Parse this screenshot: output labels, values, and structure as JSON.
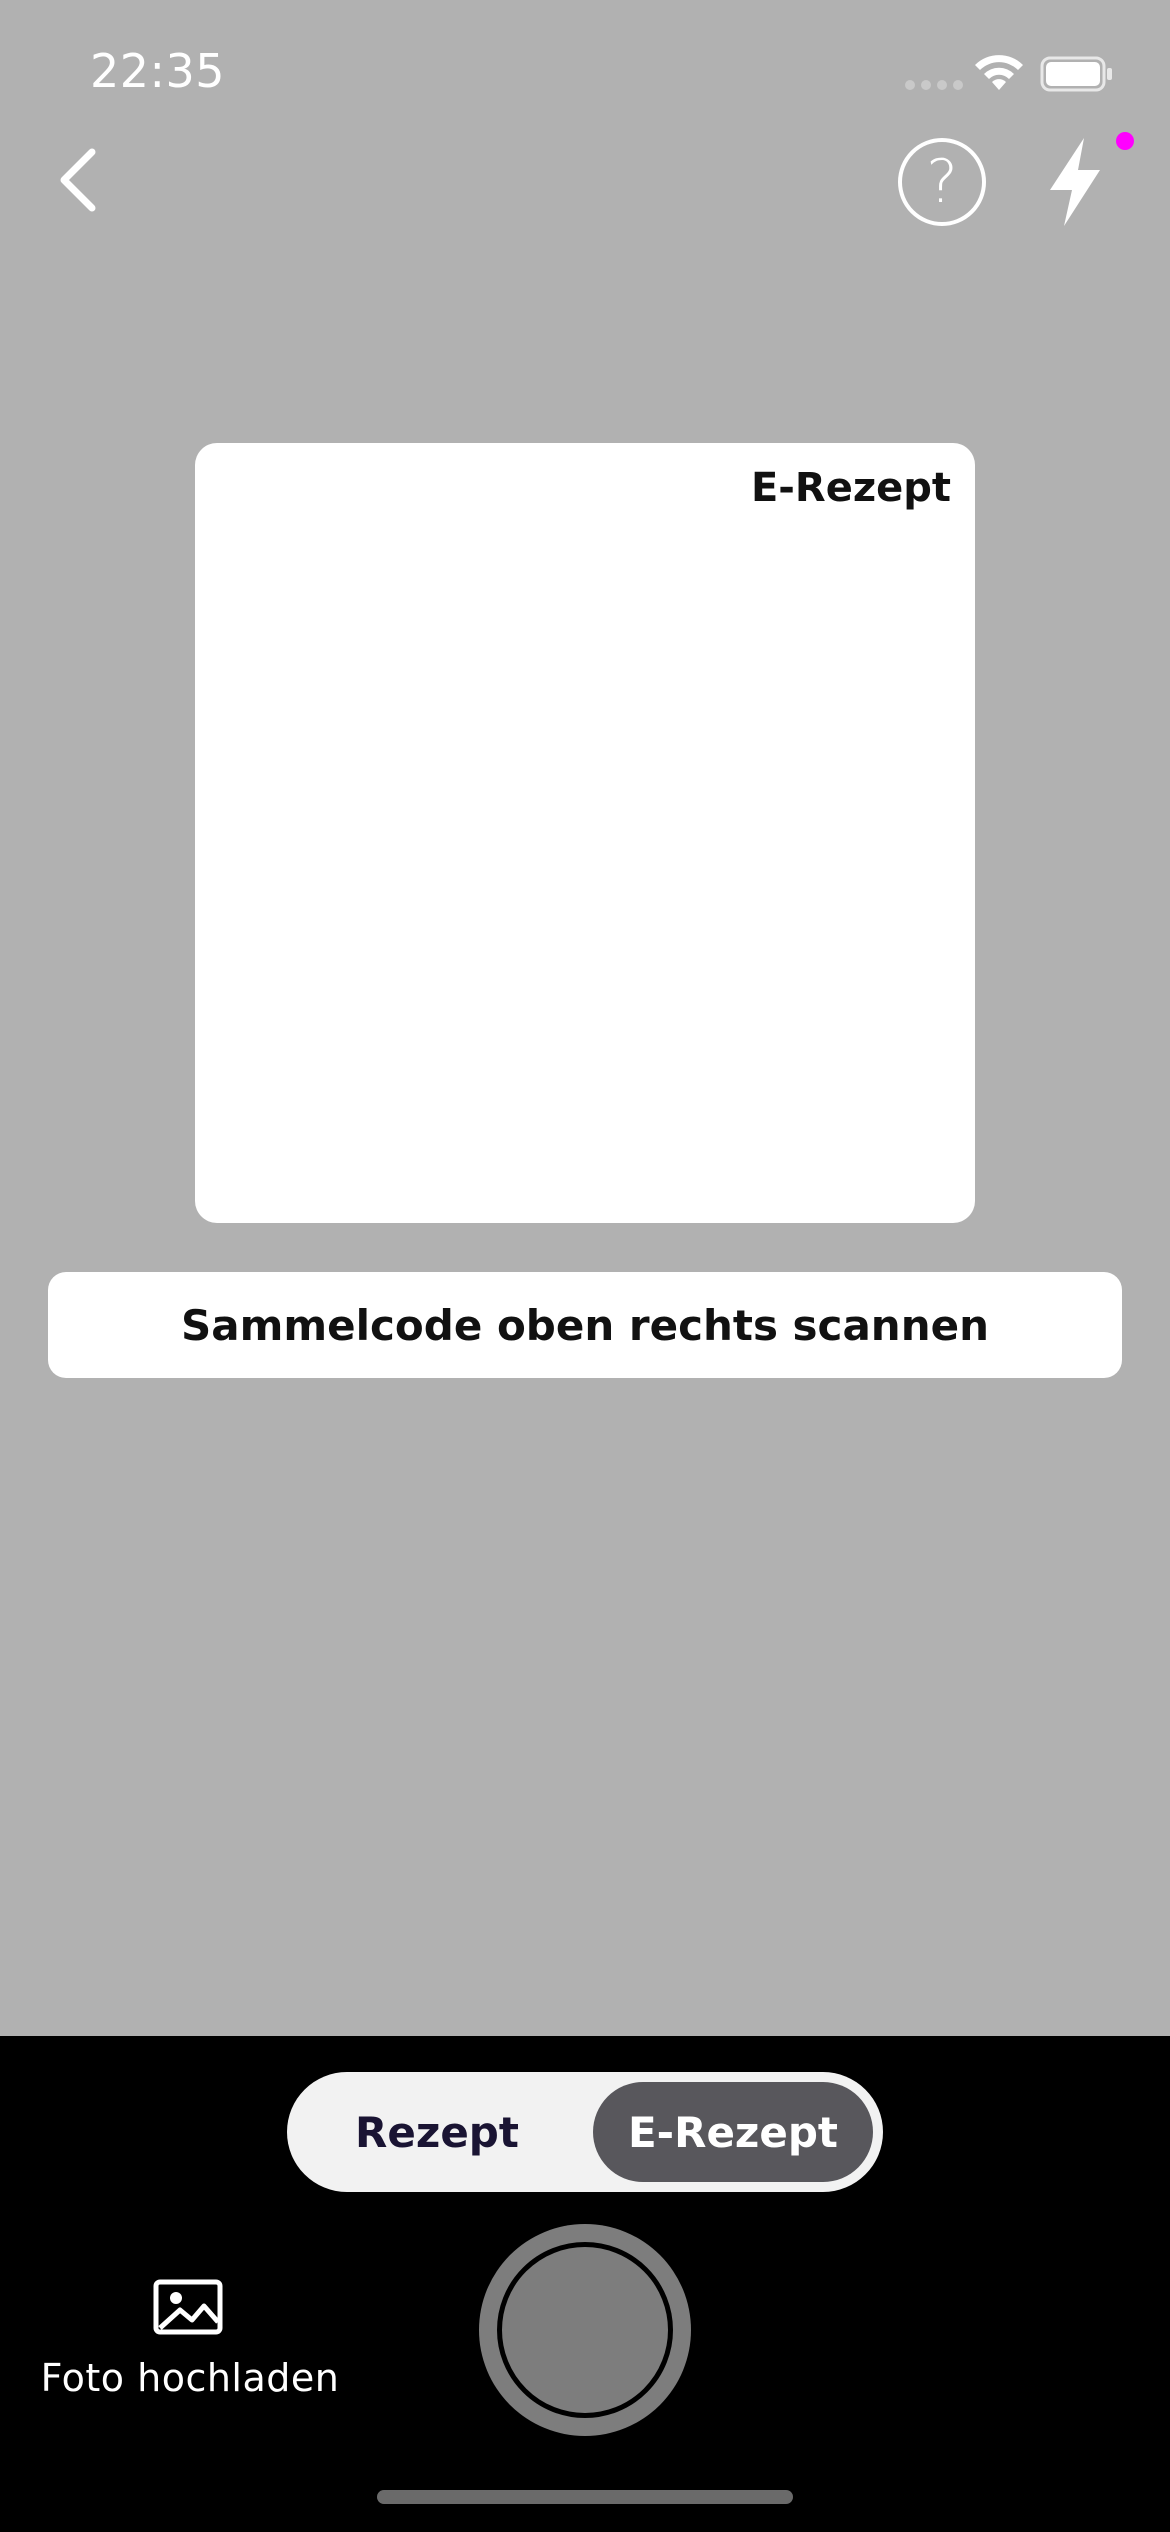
{
  "status_bar": {
    "time": "22:35",
    "icons": [
      "signal-icon",
      "wifi-icon",
      "battery-icon"
    ]
  },
  "top_bar": {
    "back_icon": "chevron-left-icon",
    "help_icon": "question-circle-icon",
    "help_glyph": "?",
    "flash_icon": "lightning-icon",
    "notification_color": "#ff00ff"
  },
  "scanner": {
    "frame_label": "E-Rezept",
    "hint": "Sammelcode oben rechts scannen"
  },
  "bottom": {
    "modes": [
      {
        "label": "Rezept",
        "selected": false
      },
      {
        "label": "E-Rezept",
        "selected": true
      }
    ],
    "upload_label": "Foto hochladen",
    "upload_icon": "image-icon",
    "shutter_icon": "shutter-button"
  },
  "colors": {
    "background": "#b1b1b1",
    "panel": "#000000",
    "toggle_selected": "#58575c",
    "toggle_text": "#1a1433"
  }
}
